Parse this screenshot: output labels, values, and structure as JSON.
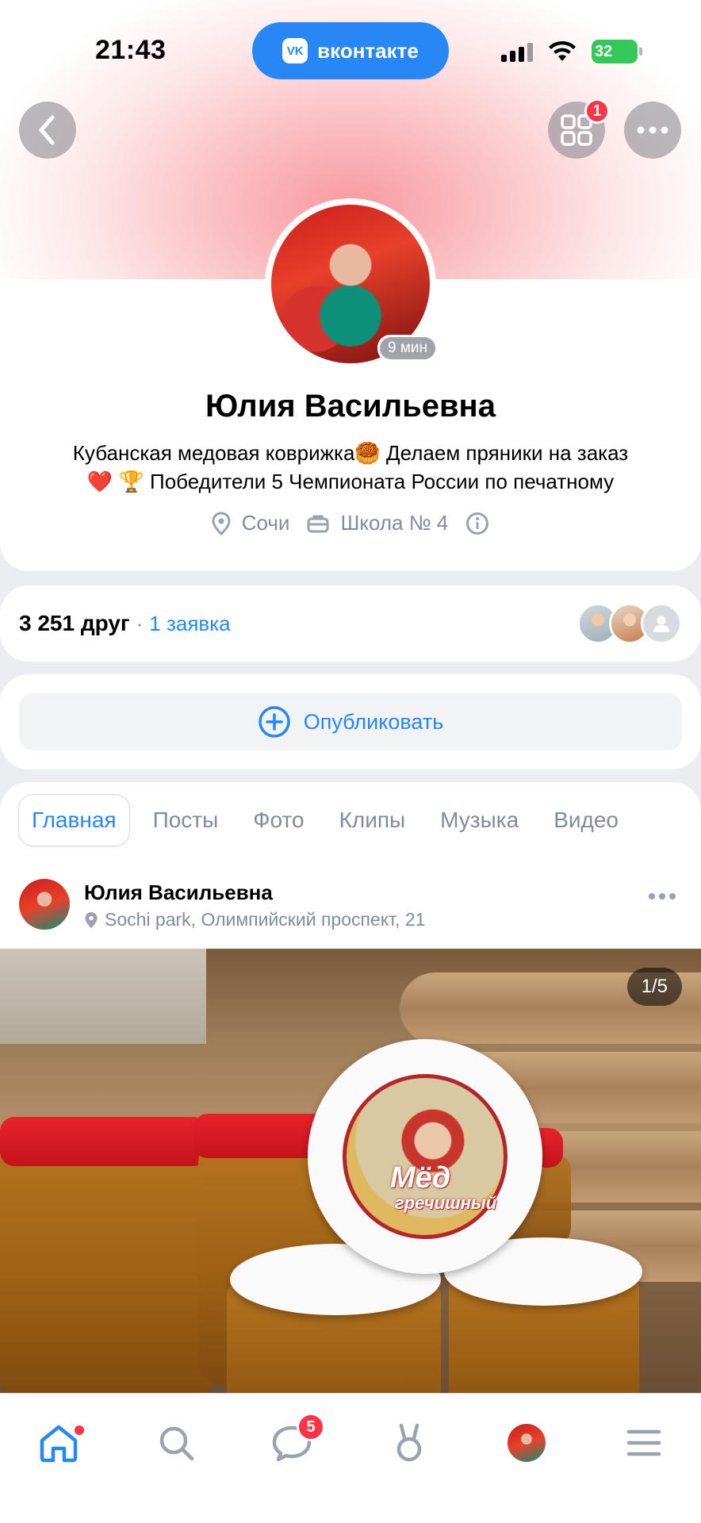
{
  "status_bar": {
    "time": "21:43",
    "app_pill": "вконтакте",
    "battery": "32"
  },
  "header": {
    "apps_badge": "1"
  },
  "profile": {
    "online_time": "9 мин",
    "name": "Юлия Васильевна",
    "status_line1": "Кубанская медовая коврижка🥮 Делаем пряники на заказ",
    "status_line2": "❤️ 🏆 Победители 5 Чемпионата России по печатному",
    "city": "Сочи",
    "school": "Школа № 4"
  },
  "friends": {
    "count": "3 251 друг",
    "separator": "·",
    "requests": "1 заявка"
  },
  "publish": {
    "label": "Опубликовать"
  },
  "tabs": [
    {
      "label": "Главная",
      "active": true
    },
    {
      "label": "Посты"
    },
    {
      "label": "Фото"
    },
    {
      "label": "Клипы"
    },
    {
      "label": "Музыка"
    },
    {
      "label": "Видео"
    }
  ],
  "post": {
    "author": "Юлия Васильевна",
    "location": "Sochi park, Олимпийский проспект, 21",
    "photo_counter": "1/5",
    "jar_label_line1": "Мёд",
    "jar_label_line2": "гречишный"
  },
  "bottom_nav": {
    "messages_badge": "5"
  },
  "colors": {
    "accent": "#2787f5",
    "badge": "#ff3347",
    "secondary_text": "#818c99"
  }
}
